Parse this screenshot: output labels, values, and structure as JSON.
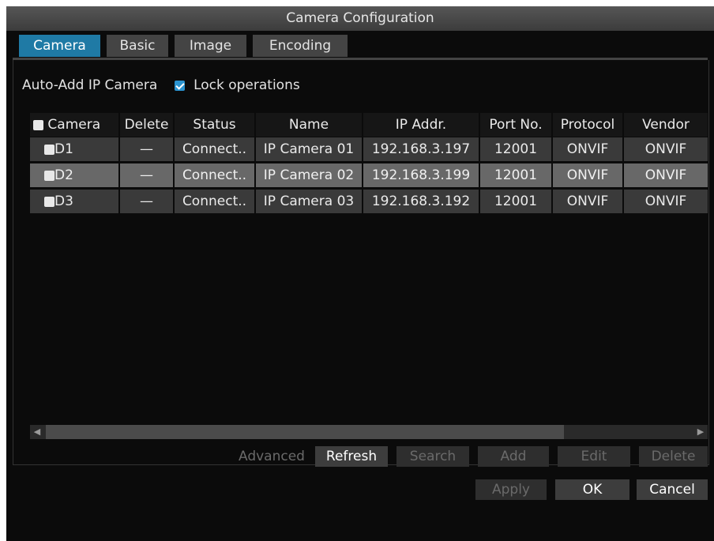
{
  "window": {
    "title": "Camera Configuration"
  },
  "tabs": [
    {
      "label": "Camera",
      "active": true
    },
    {
      "label": "Basic",
      "active": false
    },
    {
      "label": "Image",
      "active": false
    },
    {
      "label": "Encoding",
      "active": false
    }
  ],
  "auto_add": {
    "label": "Auto-Add IP Camera",
    "lock_label": "Lock operations",
    "lock_checked": true
  },
  "table": {
    "headers": [
      "Camera",
      "Delete",
      "Status",
      "Name",
      "IP Addr.",
      "Port No.",
      "Protocol",
      "Vendor"
    ],
    "rows": [
      {
        "camera": "D1",
        "delete": "—",
        "status": "Connect..",
        "name": "IP Camera 01",
        "ip": "192.168.3.197",
        "port": "12001",
        "protocol": "ONVIF",
        "vendor": "ONVIF"
      },
      {
        "camera": "D2",
        "delete": "—",
        "status": "Connect..",
        "name": "IP Camera 02",
        "ip": "192.168.3.199",
        "port": "12001",
        "protocol": "ONVIF",
        "vendor": "ONVIF"
      },
      {
        "camera": "D3",
        "delete": "—",
        "status": "Connect..",
        "name": "IP Camera 03",
        "ip": "192.168.3.192",
        "port": "12001",
        "protocol": "ONVIF",
        "vendor": "ONVIF"
      }
    ]
  },
  "scrollbar": {
    "left_icon": "arrow-left-icon",
    "right_icon": "arrow-right-icon",
    "left_glyph": "◀",
    "right_glyph": "▶"
  },
  "actions": {
    "advanced": "Advanced",
    "refresh": "Refresh",
    "search": "Search",
    "add": "Add",
    "edit": "Edit",
    "delete": "Delete"
  },
  "footer": {
    "apply": "Apply",
    "ok": "OK",
    "cancel": "Cancel"
  },
  "colors": {
    "accent": "#1f7aa5",
    "checkbox_blue": "#2a93d0",
    "background": "#0b0b0b"
  }
}
